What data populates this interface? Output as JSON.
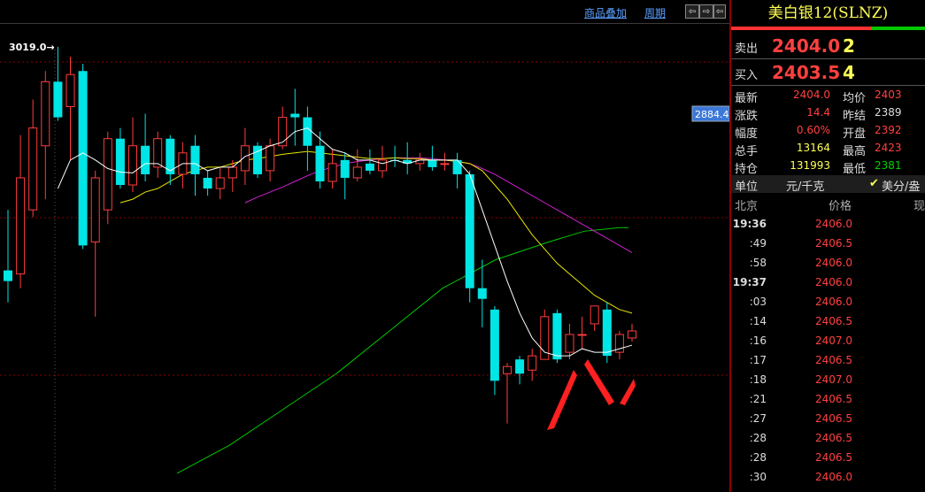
{
  "toolbar": {
    "overlay_label": "商品叠加",
    "period_label": "周期",
    "nav": [
      "⇦",
      "⇨",
      "⇦",
      "⇨"
    ]
  },
  "chart_data": {
    "type": "candlestick",
    "high_annotation": "3019.0",
    "price_marker": "2884.4",
    "candles": [
      {
        "o": 2705,
        "c": 2690,
        "h": 2790,
        "l": 2660,
        "dir": "down"
      },
      {
        "o": 2700,
        "c": 2835,
        "h": 2895,
        "l": 2680,
        "dir": "up"
      },
      {
        "o": 2790,
        "c": 2905,
        "h": 2945,
        "l": 2780,
        "dir": "up"
      },
      {
        "o": 2880,
        "c": 2970,
        "h": 2985,
        "l": 2805,
        "dir": "up"
      },
      {
        "o": 2970,
        "c": 2920,
        "h": 3019,
        "l": 2915,
        "dir": "down"
      },
      {
        "o": 2935,
        "c": 2980,
        "h": 3005,
        "l": 2860,
        "dir": "up"
      },
      {
        "o": 2985,
        "c": 2740,
        "h": 2995,
        "l": 2735,
        "dir": "down"
      },
      {
        "o": 2745,
        "c": 2835,
        "h": 2845,
        "l": 2640,
        "dir": "up"
      },
      {
        "o": 2790,
        "c": 2890,
        "h": 2900,
        "l": 2770,
        "dir": "up"
      },
      {
        "o": 2890,
        "c": 2825,
        "h": 2905,
        "l": 2820,
        "dir": "down"
      },
      {
        "o": 2825,
        "c": 2880,
        "h": 2920,
        "l": 2815,
        "dir": "up"
      },
      {
        "o": 2880,
        "c": 2840,
        "h": 2925,
        "l": 2830,
        "dir": "down"
      },
      {
        "o": 2850,
        "c": 2890,
        "h": 2900,
        "l": 2835,
        "dir": "up"
      },
      {
        "o": 2890,
        "c": 2840,
        "h": 2895,
        "l": 2825,
        "dir": "down"
      },
      {
        "o": 2840,
        "c": 2870,
        "h": 2885,
        "l": 2820,
        "dir": "up"
      },
      {
        "o": 2880,
        "c": 2840,
        "h": 2895,
        "l": 2810,
        "dir": "down"
      },
      {
        "o": 2835,
        "c": 2820,
        "h": 2845,
        "l": 2810,
        "dir": "down"
      },
      {
        "o": 2820,
        "c": 2835,
        "h": 2850,
        "l": 2805,
        "dir": "up"
      },
      {
        "o": 2835,
        "c": 2850,
        "h": 2860,
        "l": 2815,
        "dir": "up"
      },
      {
        "o": 2845,
        "c": 2880,
        "h": 2905,
        "l": 2825,
        "dir": "up"
      },
      {
        "o": 2880,
        "c": 2840,
        "h": 2885,
        "l": 2835,
        "dir": "down"
      },
      {
        "o": 2845,
        "c": 2880,
        "h": 2890,
        "l": 2830,
        "dir": "up"
      },
      {
        "o": 2880,
        "c": 2920,
        "h": 2935,
        "l": 2875,
        "dir": "up"
      },
      {
        "o": 2925,
        "c": 2920,
        "h": 2960,
        "l": 2880,
        "dir": "down"
      },
      {
        "o": 2920,
        "c": 2880,
        "h": 2935,
        "l": 2845,
        "dir": "down"
      },
      {
        "o": 2880,
        "c": 2830,
        "h": 2900,
        "l": 2820,
        "dir": "down"
      },
      {
        "o": 2830,
        "c": 2855,
        "h": 2875,
        "l": 2820,
        "dir": "up"
      },
      {
        "o": 2860,
        "c": 2835,
        "h": 2870,
        "l": 2805,
        "dir": "down"
      },
      {
        "o": 2835,
        "c": 2850,
        "h": 2875,
        "l": 2830,
        "dir": "up"
      },
      {
        "o": 2855,
        "c": 2845,
        "h": 2875,
        "l": 2840,
        "dir": "down"
      },
      {
        "o": 2845,
        "c": 2860,
        "h": 2880,
        "l": 2835,
        "dir": "up"
      },
      {
        "o": 2860,
        "c": 2860,
        "h": 2880,
        "l": 2850,
        "dir": "down"
      },
      {
        "o": 2860,
        "c": 2855,
        "h": 2885,
        "l": 2840,
        "dir": "down"
      },
      {
        "o": 2855,
        "c": 2860,
        "h": 2870,
        "l": 2845,
        "dir": "up"
      },
      {
        "o": 2860,
        "c": 2850,
        "h": 2880,
        "l": 2845,
        "dir": "down"
      },
      {
        "o": 2855,
        "c": 2855,
        "h": 2870,
        "l": 2845,
        "dir": "up"
      },
      {
        "o": 2860,
        "c": 2840,
        "h": 2870,
        "l": 2820,
        "dir": "down"
      },
      {
        "o": 2840,
        "c": 2680,
        "h": 2845,
        "l": 2660,
        "dir": "down"
      },
      {
        "o": 2680,
        "c": 2665,
        "h": 2720,
        "l": 2625,
        "dir": "down"
      },
      {
        "o": 2650,
        "c": 2550,
        "h": 2655,
        "l": 2530,
        "dir": "down"
      },
      {
        "o": 2560,
        "c": 2570,
        "h": 2575,
        "l": 2490,
        "dir": "up"
      },
      {
        "o": 2580,
        "c": 2560,
        "h": 2585,
        "l": 2545,
        "dir": "down"
      },
      {
        "o": 2565,
        "c": 2585,
        "h": 2595,
        "l": 2550,
        "dir": "up"
      },
      {
        "o": 2580,
        "c": 2640,
        "h": 2650,
        "l": 2580,
        "dir": "up"
      },
      {
        "o": 2645,
        "c": 2580,
        "h": 2650,
        "l": 2575,
        "dir": "down"
      },
      {
        "o": 2590,
        "c": 2615,
        "h": 2630,
        "l": 2580,
        "dir": "up"
      },
      {
        "o": 2615,
        "c": 2615,
        "h": 2640,
        "l": 2595,
        "dir": "up"
      },
      {
        "o": 2630,
        "c": 2655,
        "h": 2655,
        "l": 2620,
        "dir": "up"
      },
      {
        "o": 2650,
        "c": 2585,
        "h": 2660,
        "l": 2575,
        "dir": "down"
      },
      {
        "o": 2590,
        "c": 2615,
        "h": 2620,
        "l": 2580,
        "dir": "up"
      },
      {
        "o": 2610,
        "c": 2620,
        "h": 2630,
        "l": 2605,
        "dir": "up"
      }
    ],
    "ma_white": [
      null,
      null,
      null,
      null,
      2820,
      2860,
      2870,
      2860,
      2848,
      2843,
      2842,
      2855,
      2855,
      2845,
      2855,
      2855,
      2845,
      2850,
      2850,
      2865,
      2872,
      2880,
      2885,
      2900,
      2905,
      2890,
      2875,
      2870,
      2860,
      2860,
      2855,
      2860,
      2855,
      2860,
      2860,
      2860,
      2860,
      2840,
      2790,
      2740,
      2690,
      2645,
      2610,
      2590,
      2585,
      2585,
      2595,
      2590,
      2590,
      2595,
      2600
    ],
    "ma_yellow": [
      null,
      null,
      null,
      null,
      null,
      null,
      null,
      null,
      null,
      2800,
      2805,
      2815,
      2820,
      2830,
      2840,
      2845,
      2850,
      2850,
      2855,
      2860,
      2862,
      2865,
      2868,
      2870,
      2872,
      2870,
      2868,
      2866,
      2864,
      2862,
      2862,
      2863,
      2862,
      2862,
      2860,
      2860,
      2858,
      2855,
      2845,
      2825,
      2805,
      2780,
      2755,
      2735,
      2715,
      2700,
      2685,
      2670,
      2660,
      2650,
      2645
    ],
    "ma_magenta": [
      null,
      null,
      null,
      null,
      null,
      null,
      null,
      null,
      null,
      null,
      null,
      null,
      null,
      null,
      null,
      null,
      null,
      null,
      null,
      2800,
      2808,
      2815,
      2822,
      2830,
      2838,
      2845,
      2850,
      2855,
      2858,
      2860,
      2862,
      2863,
      2863,
      2863,
      2862,
      2860,
      2858,
      2855,
      2848,
      2840,
      2830,
      2820,
      2810,
      2800,
      2790,
      2780,
      2770,
      2760,
      2750,
      2740,
      2730
    ],
    "ma_green": [
      null,
      null,
      null,
      null,
      null,
      null,
      null,
      null,
      null,
      null,
      null,
      null,
      null,
      null,
      null,
      null,
      null,
      null,
      null,
      null,
      null,
      null,
      null,
      null,
      null,
      null,
      null,
      null,
      null,
      null,
      null,
      null,
      null,
      null,
      null,
      null,
      null,
      null,
      null,
      null,
      null,
      null,
      null,
      null,
      null,
      null,
      null,
      null,
      null,
      null,
      null
    ],
    "green_line": [
      [
        200,
        2420
      ],
      [
        260,
        2460
      ],
      [
        320,
        2510
      ],
      [
        380,
        2560
      ],
      [
        440,
        2620
      ],
      [
        500,
        2680
      ],
      [
        560,
        2720
      ],
      [
        620,
        2745
      ],
      [
        660,
        2760
      ],
      [
        700,
        2765
      ],
      [
        710,
        2765
      ]
    ],
    "ymin": 2400,
    "ymax": 3040,
    "colors": {
      "up": "#ff3c3c",
      "down": "#00e5e5",
      "white": "#ffffff",
      "yellow": "#e6e600",
      "magenta": "#d020d0",
      "green": "#00c800",
      "grid": "#8a0000",
      "marker_bg": "#3c78d8"
    }
  },
  "panel": {
    "title": "美白银12(SLNZ)",
    "sell": {
      "label": "卖出",
      "price": "2404.0",
      "vol": "2"
    },
    "buy": {
      "label": "买入",
      "price": "2403.5",
      "vol": "4"
    },
    "stats": [
      {
        "l1": "最新",
        "v1": "2404.0",
        "c1": "#ff4040",
        "l2": "均价",
        "v2": "2403",
        "c2": "#ff4040"
      },
      {
        "l1": "涨跌",
        "v1": "14.4",
        "c1": "#ff4040",
        "l2": "昨结",
        "v2": "2389",
        "c2": "#dddddd"
      },
      {
        "l1": "幅度",
        "v1": "0.60%",
        "c1": "#ff4040",
        "l2": "开盘",
        "v2": "2392",
        "c2": "#ff4040"
      },
      {
        "l1": "总手",
        "v1": "13164",
        "c1": "#ffff55",
        "l2": "最高",
        "v2": "2423",
        "c2": "#ff4040"
      },
      {
        "l1": "持仓",
        "v1": "131993",
        "c1": "#ffff55",
        "l2": "最低",
        "v2": "2381",
        "c2": "#00d000"
      }
    ],
    "unit_label": "单位",
    "unit_value": "元/千克",
    "unit_alt": "美分/盎",
    "ticks_head": {
      "time": "北京",
      "price": "价格",
      "vol": "现"
    },
    "ticks": [
      {
        "t": "19:36",
        "p": "2406.0",
        "full": true
      },
      {
        "t": ":49",
        "p": "2406.5",
        "full": false
      },
      {
        "t": ":58",
        "p": "2406.0",
        "full": false
      },
      {
        "t": "19:37",
        "p": "2406.0",
        "full": true
      },
      {
        "t": ":03",
        "p": "2406.0",
        "full": false
      },
      {
        "t": ":14",
        "p": "2406.5",
        "full": false
      },
      {
        "t": ":16",
        "p": "2407.0",
        "full": false
      },
      {
        "t": ":17",
        "p": "2406.5",
        "full": false
      },
      {
        "t": ":18",
        "p": "2407.0",
        "full": false
      },
      {
        "t": ":21",
        "p": "2406.5",
        "full": false
      },
      {
        "t": ":27",
        "p": "2406.5",
        "full": false
      },
      {
        "t": ":28",
        "p": "2406.5",
        "full": false
      },
      {
        "t": ":28",
        "p": "2406.5",
        "full": false
      },
      {
        "t": ":30",
        "p": "2406.0",
        "full": false
      }
    ]
  }
}
